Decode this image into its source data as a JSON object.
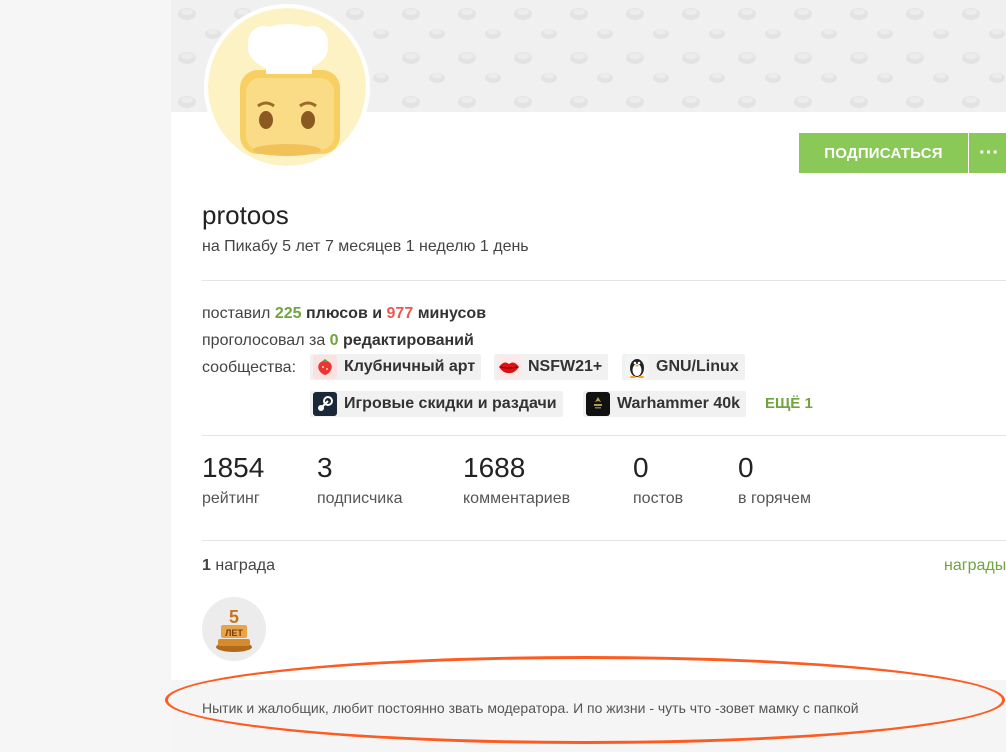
{
  "profile": {
    "username": "protoos",
    "membership": "на Пикабу 5 лет 7 месяцев 1 неделю 1 день"
  },
  "actions": {
    "subscribe_label": "ПОДПИСАТЬСЯ",
    "more_label": "···"
  },
  "votes": {
    "prefix": "поставил",
    "plus_count": "225",
    "plus_word": "плюсов и",
    "minus_count": "977",
    "minus_word": "минусов",
    "edits_prefix": "проголосовал за",
    "edits_count": "0",
    "edits_word": "редактирований"
  },
  "communities": {
    "label": "сообщества:",
    "items": [
      {
        "name": "Клубничный арт",
        "icon": "strawberry-icon"
      },
      {
        "name": "NSFW21+",
        "icon": "lips-icon"
      },
      {
        "name": "GNU/Linux",
        "icon": "penguin-icon"
      },
      {
        "name": "Игровые скидки и раздачи",
        "icon": "steam-icon"
      },
      {
        "name": "Warhammer 40k",
        "icon": "warhammer-icon"
      }
    ],
    "more_label": "ЕЩЁ 1"
  },
  "stats": [
    {
      "value": "1854",
      "label": "рейтинг"
    },
    {
      "value": "3",
      "label": "подписчика"
    },
    {
      "value": "1688",
      "label": "комментариев"
    },
    {
      "value": "0",
      "label": "постов"
    },
    {
      "value": "0",
      "label": "в горячем"
    }
  ],
  "awards": {
    "count": "1",
    "count_word": "награда",
    "link_label": "награды",
    "badge_text": "5 ЛЕТ"
  },
  "about": {
    "text": "Нытик и жалобщик, любит постоянно звать модератора. И по жизни - чуть что -зовет мамку с папкой"
  },
  "colors": {
    "accent": "#8ac858",
    "plus": "#6fa43e",
    "minus": "#e95a4f",
    "highlight": "#ff5a1f"
  }
}
